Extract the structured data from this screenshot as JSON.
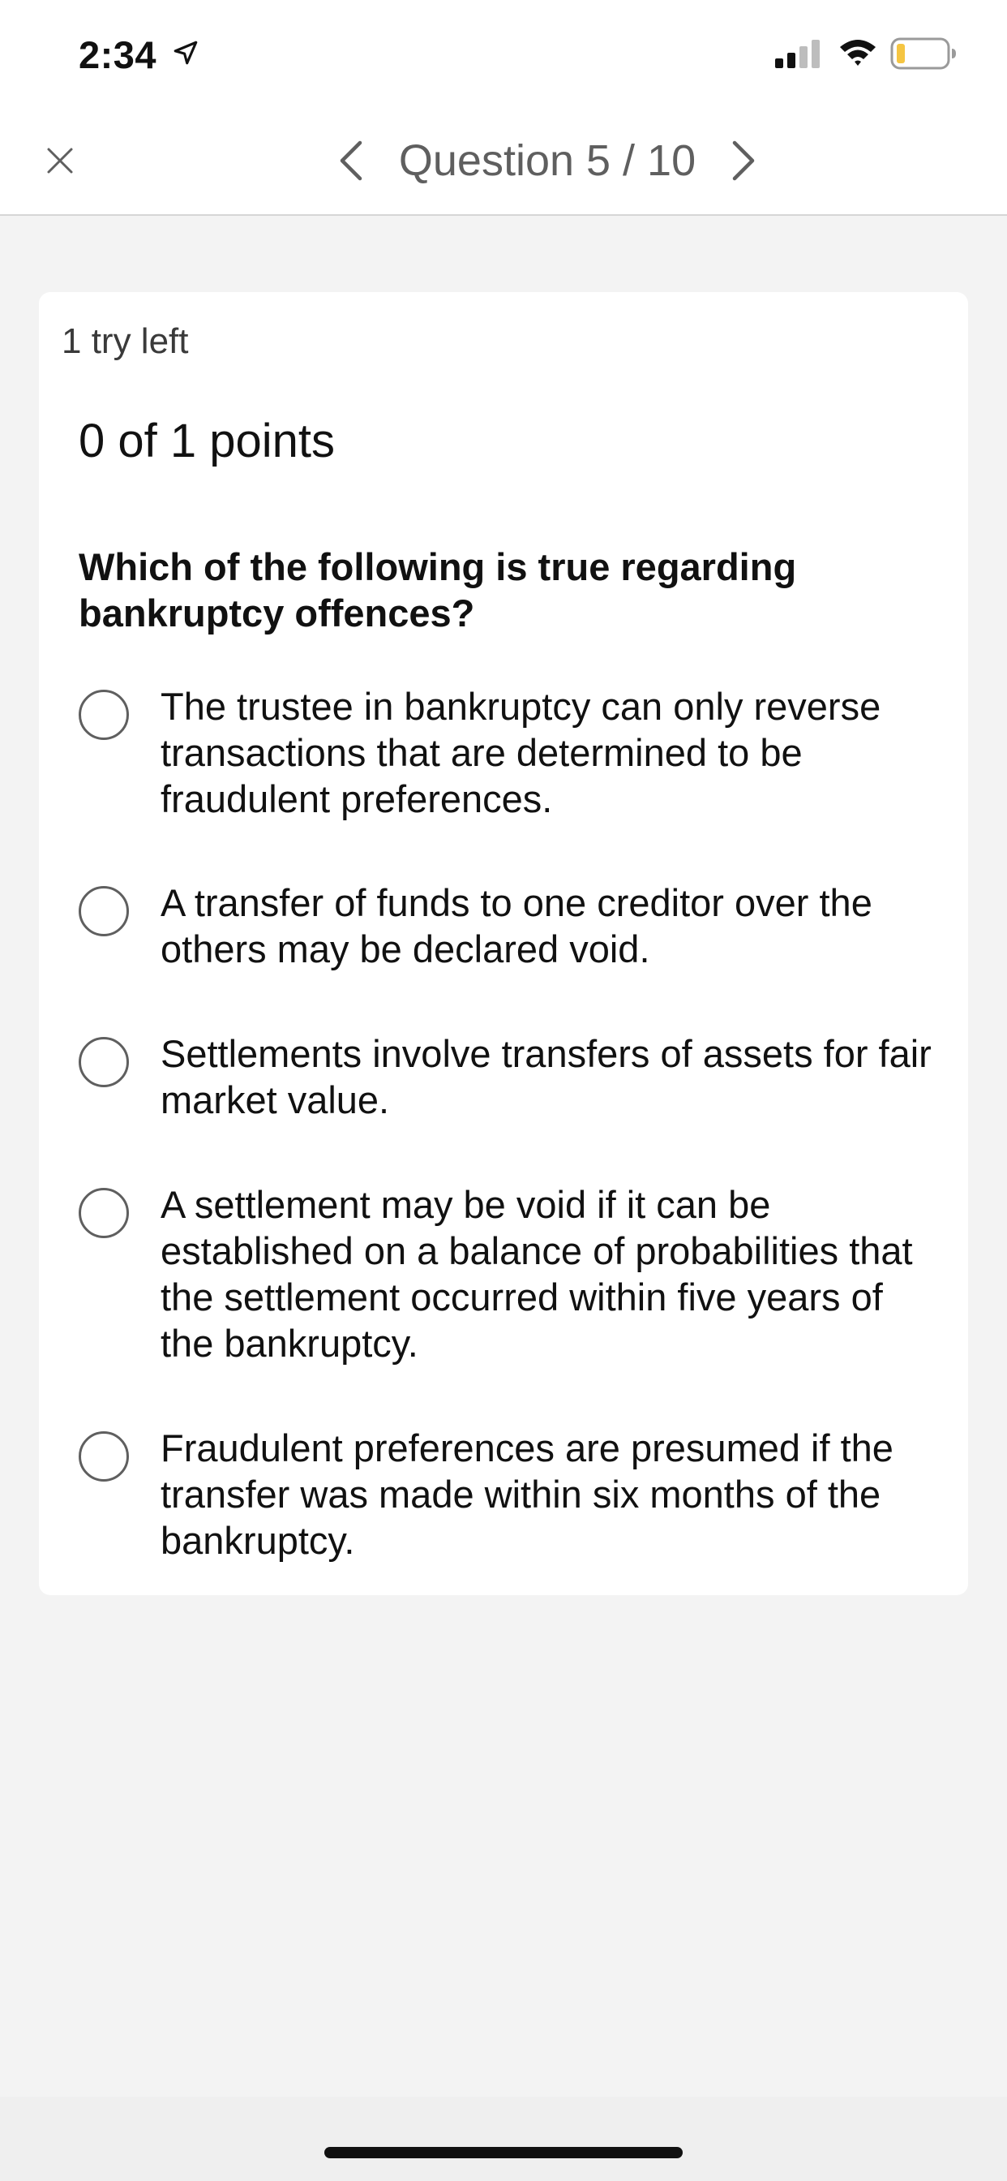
{
  "status_bar": {
    "time": "2:34",
    "location_icon": "location-arrow-icon",
    "signal_icon": "cellular-signal-icon",
    "wifi_icon": "wifi-icon",
    "battery_icon": "battery-low-icon",
    "battery_color": "#f5c542"
  },
  "nav": {
    "close_icon": "close-icon",
    "prev_icon": "chevron-left-icon",
    "next_icon": "chevron-right-icon",
    "title": "Question 5 / 10"
  },
  "card": {
    "tries_left": "1 try left",
    "points": "0 of 1 points",
    "question": "Which of the following is true regarding bankruptcy offences?",
    "options": [
      {
        "label": "The trustee in bankruptcy can only reverse transactions that are determined to be fraudulent preferences.",
        "selected": false
      },
      {
        "label": "A transfer of funds to one creditor over the others may be declared void.",
        "selected": false
      },
      {
        "label": "Settlements involve transfers of assets for fair market value.",
        "selected": false
      },
      {
        "label": "A settlement may be void if it can be established on a balance of probabilities that the settlement occurred within five years of the bankruptcy.",
        "selected": false
      },
      {
        "label": "Fraudulent preferences are presumed if the transfer was made within six months of the bankruptcy.",
        "selected": false
      }
    ]
  },
  "colors": {
    "background": "#f3f3f3",
    "card": "#ffffff",
    "nav_text": "#5f5f5f",
    "radio_border": "#5f5f5f"
  }
}
